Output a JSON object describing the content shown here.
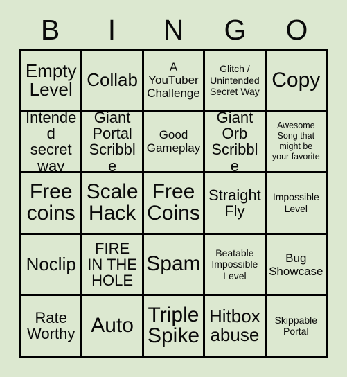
{
  "card": {
    "title": "BINGO",
    "background_color": "#dce8d0",
    "cell_color": "#dce8d0",
    "line_color": "#000000",
    "text_color": "#0a0a0a"
  },
  "header": {
    "letters": [
      "B",
      "I",
      "N",
      "G",
      "O"
    ]
  },
  "grid": {
    "rows": 5,
    "columns": 5,
    "cells": [
      {
        "text": "Empty\nLevel",
        "size": "lg"
      },
      {
        "text": "Collab",
        "size": "lg"
      },
      {
        "text": "A\nYouTuber\nChallenge",
        "size": "sm"
      },
      {
        "text": "Glitch /\nUnintended\nSecret Way",
        "size": "xs"
      },
      {
        "text": "Copy",
        "size": "xl"
      },
      {
        "text": "Intended\nsecret\nway",
        "size": "md"
      },
      {
        "text": "Giant\nPortal\nScribble",
        "size": "md"
      },
      {
        "text": "Good\nGameplay",
        "size": "sm"
      },
      {
        "text": "Giant\nOrb\nScribble",
        "size": "md"
      },
      {
        "text": "Awesome\nSong that\nmight be\nyour favorite",
        "size": "xxs"
      },
      {
        "text": "Free\ncoins",
        "size": "xl"
      },
      {
        "text": "Scale\nHack",
        "size": "xl"
      },
      {
        "text": "Free\nCoins",
        "size": "xl"
      },
      {
        "text": "Straight\nFly",
        "size": "md"
      },
      {
        "text": "Impossible\nLevel",
        "size": "xs"
      },
      {
        "text": "Noclip",
        "size": "lg"
      },
      {
        "text": "FIRE\nIN THE\nHOLE",
        "size": "md"
      },
      {
        "text": "Spam",
        "size": "xl"
      },
      {
        "text": "Beatable\nImpossible\nLevel",
        "size": "xs"
      },
      {
        "text": "Bug\nShowcase",
        "size": "sm"
      },
      {
        "text": "Rate\nWorthy",
        "size": "md"
      },
      {
        "text": "Auto",
        "size": "xl"
      },
      {
        "text": "Triple\nSpike",
        "size": "xl"
      },
      {
        "text": "Hitbox\nabuse",
        "size": "lg"
      },
      {
        "text": "Skippable\nPortal",
        "size": "xs"
      }
    ]
  }
}
